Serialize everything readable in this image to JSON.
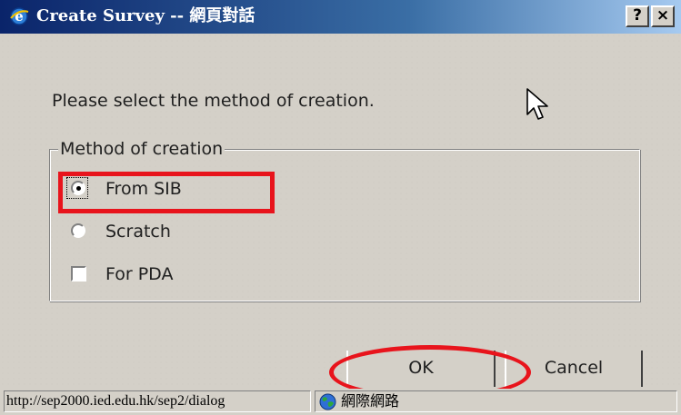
{
  "window": {
    "title": "Create Survey -- 網頁對話",
    "help_label": "?",
    "close_label": "×"
  },
  "dialog": {
    "prompt": "Please select the method of creation.",
    "group_label": "Method of creation",
    "options": [
      {
        "label": "From SIB",
        "type": "radio",
        "selected": true
      },
      {
        "label": "Scratch",
        "type": "radio",
        "selected": false
      },
      {
        "label": "For PDA",
        "type": "checkbox",
        "checked": false
      }
    ],
    "ok_label": "OK",
    "cancel_label": "Cancel"
  },
  "statusbar": {
    "url": "http://sep2000.ied.edu.hk/sep2/dialog",
    "zone": "網際網路"
  },
  "colors": {
    "titlebar_start": "#0a246a",
    "titlebar_end": "#a6caf0",
    "face": "#d4d0c8",
    "annotation": "#e8141c"
  },
  "icons": [
    "ie-icon",
    "cursor-arrow-icon",
    "globe-icon"
  ]
}
